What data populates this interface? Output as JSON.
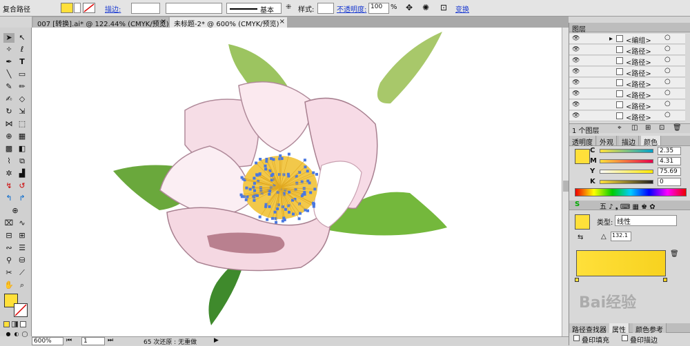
{
  "control_bar": {
    "selection_name": "复合路径",
    "stroke_label": "描边:",
    "stroke_weight": "",
    "brush_label": "基本",
    "style_label": "样式:",
    "opacity_label": "不透明度:",
    "opacity_value": "100",
    "percent": "%",
    "transform_label": "变换"
  },
  "tabs": [
    {
      "label": "007 [转换].ai* @ 122.44% (CMYK/预览)",
      "close": "×"
    },
    {
      "label": "未标题-2* @ 600% (CMYK/预览)",
      "close": "×"
    }
  ],
  "status": {
    "zoom": "600%",
    "page": "1",
    "undo_text": "65 次还原 : 无重做"
  },
  "layers_panel": {
    "title": "图层",
    "rows": [
      {
        "label": "<编组>"
      },
      {
        "label": "<路径>"
      },
      {
        "label": "<路径>"
      },
      {
        "label": "<路径>"
      },
      {
        "label": "<路径>"
      },
      {
        "label": "<路径>"
      },
      {
        "label": "<路径>"
      },
      {
        "label": "<路径>"
      }
    ],
    "footer": "1 个图层"
  },
  "color_panel": {
    "tabs": [
      "透明度",
      "外观",
      "描边",
      "颜色"
    ],
    "channels": [
      {
        "name": "C",
        "value": "2.35"
      },
      {
        "name": "M",
        "value": "4.31"
      },
      {
        "name": "Y",
        "value": "75.69"
      },
      {
        "name": "K",
        "value": "0"
      }
    ],
    "fill_color": "#ffe03a"
  },
  "gradient_panel": {
    "type_label": "类型:",
    "type_value": "线性",
    "angle_value": "132.1"
  },
  "bottom_panel": {
    "tabs": [
      "路径查找器",
      "属性",
      "颜色参考"
    ],
    "overprint_fill": "叠印填充",
    "overprint_stroke": "叠印描边"
  },
  "watermark": "Bai经验"
}
